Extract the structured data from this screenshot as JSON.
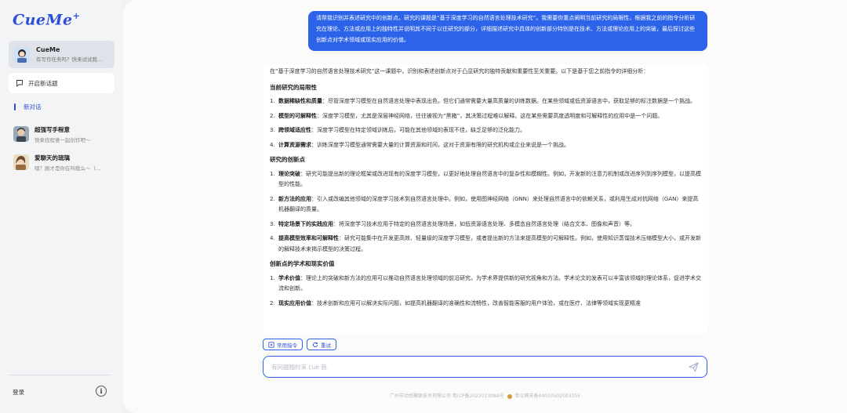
{
  "app": {
    "logo": "CueMe",
    "logo_mark": "+"
  },
  "sidebar": {
    "bot": {
      "name": "CueMe",
      "desc": "有写作任务吗？快来试试我…"
    },
    "new_chat_label": "开启新话题",
    "active_conversation": "新对话",
    "history": [
      {
        "name": "超强写手程意",
        "desc": "快来找程意一起创作吧～"
      },
      {
        "name": "爱聊天的琉璃",
        "desc": "嘿？刚才是你在叫我么～（…"
      }
    ],
    "login_label": "登录",
    "info_label": "i"
  },
  "chat": {
    "user_message": "请帮我识别并表述研究中的创新点。研究的课题是“基于深度学习的自然语言处理技术研究”。我需要你重点阐明当前研究的局限性，根据我之前的指令分析研究在理论、方法或应用上的独特性并说明其不同于以往研究的部分，详细描述研究中具体的创新部分特别是在技术、方法或理论应用上的突破，最后探讨这些创新点对学术领域或现实应用的价值。",
    "answer": {
      "intro": "在“基于深度学习的自然语言处理技术研究”这一课题中，识别和表述创新点对于凸显研究的独特贡献和重要性至关重要。以下是基于您之前指令的详细分析：",
      "sections": [
        {
          "heading": "当前研究的局限性",
          "items": [
            {
              "num": "1.",
              "title": "数据稀缺性和质量",
              "text": "：尽管深度学习模型在自然语言处理中表现出色，但它们通常需要大量高质量的训练数据。在某些领域或低资源语言中，获取足够的标注数据是一个挑战。"
            },
            {
              "num": "2.",
              "title": "模型的可解释性",
              "text": "：深度学习模型，尤其是深层神经网络，往往被视为“黑箱”，其决策过程难以解释。这在某些需要高度透明度和可解释性的应用中是一个问题。"
            },
            {
              "num": "3.",
              "title": "跨领域适应性",
              "text": "：深度学习模型在特定领域训练后，可能在其他领域的表现不佳，缺乏足够的泛化能力。"
            },
            {
              "num": "4.",
              "title": "计算资源需求",
              "text": "：训练深度学习模型通常需要大量的计算资源和时间，这对于资源有限的研究机构或企业来说是一个挑战。"
            }
          ]
        },
        {
          "heading": "研究的创新点",
          "items": [
            {
              "num": "1.",
              "title": "理论突破",
              "text": "：研究可能提出新的理论框架或改进现有的深度学习模型，以更好地处理自然语言中的复杂性和模糊性。例如，开发新的注意力机制或改进序列到序列模型，以提高模型的性能。"
            },
            {
              "num": "2.",
              "title": "新方法的应用",
              "text": "：引入或改编其他领域的深度学习技术到自然语言处理中。例如，使用图神经网络（GNN）来处理自然语言中的依赖关系，或利用生成对抗网络（GAN）来提高机器翻译的质量。"
            },
            {
              "num": "3.",
              "title": "特定场景下的实践应用",
              "text": "：将深度学习技术应用于特定的自然语言处理场景，如低资源语言处理、多模态自然语言处理（结合文本、图像和声音）等。"
            },
            {
              "num": "4.",
              "title": "提高模型效率和可解释性",
              "text": "：研究可能集中在开发更高效、轻量级的深度学习模型，或者提出新的方法来提高模型的可解释性。例如，使用知识蒸馏技术压缩模型大小，或开发新的解释技术来揭示模型的决策过程。"
            }
          ]
        },
        {
          "heading": "创新点的学术和现实价值",
          "items": [
            {
              "num": "1.",
              "title": "学术价值",
              "text": "：理论上的突破和新方法的应用可以推动自然语言处理领域的前沿研究，为学术界提供新的研究视角和方法。学术论文的发表可以丰富该领域的理论体系，促进学术交流和创新。"
            },
            {
              "num": "2.",
              "title": "现实应用价值",
              "text": "：技术创新和应用可以解决实际问题，如提高机器翻译的准确性和流畅性，改善智能客服的用户体验，或在医疗、法律等领域实现更精准"
            }
          ]
        }
      ]
    }
  },
  "composer": {
    "quick_actions": [
      {
        "label": "常用指令"
      },
      {
        "label": "重试"
      }
    ],
    "placeholder": "有问题随时来 cue 我"
  },
  "footer": {
    "icp": "广州市动悦聚联技术有限公司 粤ICP备2022013084号",
    "police": "粤公网安备44010502003355"
  },
  "colors": {
    "accent": "#2d63e8",
    "sidebar_bg": "#f3f4f6",
    "main_bg": "#fbfbfc"
  }
}
